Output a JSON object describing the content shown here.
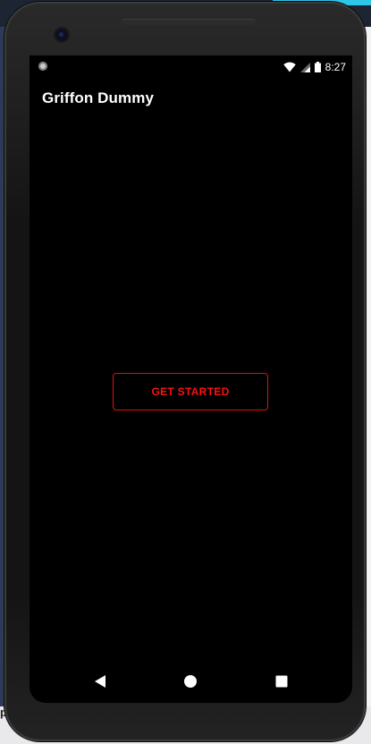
{
  "app": {
    "title": "Griffon Dummy"
  },
  "status_bar": {
    "time": "8:27",
    "icons": [
      "notification-dot-icon",
      "wifi-icon",
      "signal-icon",
      "battery-icon"
    ]
  },
  "main": {
    "cta_label": "GET STARTED"
  },
  "nav_bar": {
    "buttons": [
      "back-triangle-icon",
      "home-circle-icon",
      "recents-square-icon"
    ]
  },
  "colors": {
    "screen_background": "#000000",
    "accent": "#ff1010",
    "text": "#ffffff"
  },
  "desktop_edge": {
    "bottom_left_fragment": "p"
  }
}
